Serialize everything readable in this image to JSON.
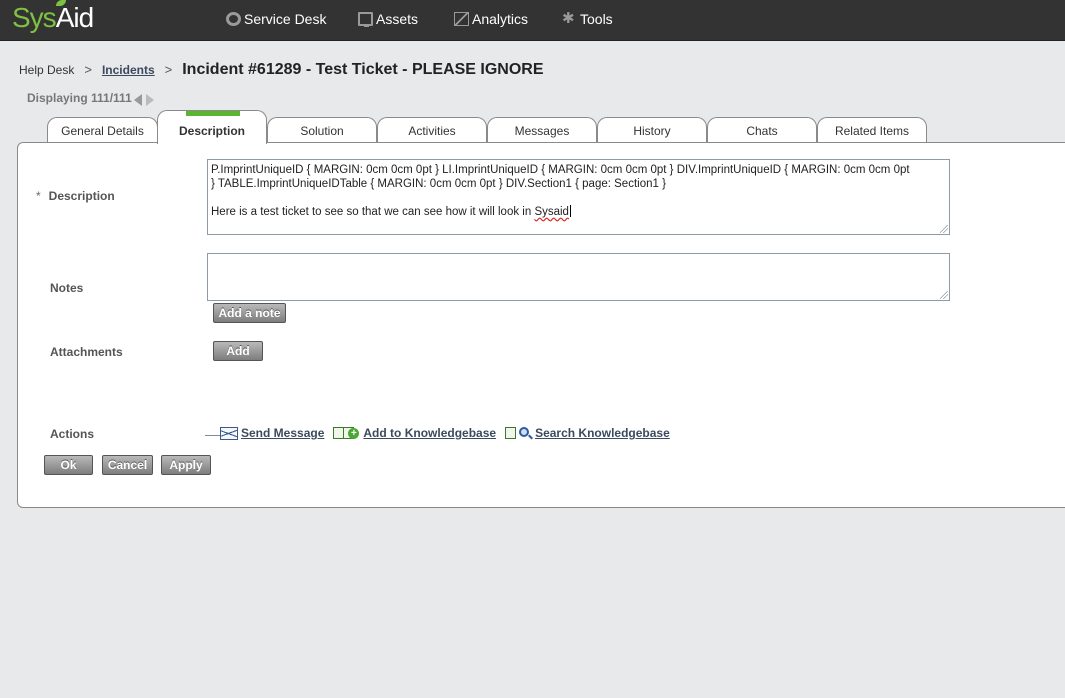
{
  "app": {
    "logo_sys": "Sys",
    "logo_aid": "Aid"
  },
  "nav": [
    {
      "label": "Service Desk",
      "icon": "service-desk-icon"
    },
    {
      "label": "Assets",
      "icon": "monitor-icon"
    },
    {
      "label": "Analytics",
      "icon": "chart-icon"
    },
    {
      "label": "Tools",
      "icon": "puzzle-icon"
    }
  ],
  "breadcrumb": {
    "root": "Help Desk",
    "sep": ">",
    "parent": "Incidents",
    "title": "Incident #61289 -  Test Ticket - PLEASE IGNORE"
  },
  "displaying": "Displaying 111/111",
  "tabs": [
    {
      "label": "General Details"
    },
    {
      "label": "Description"
    },
    {
      "label": "Solution"
    },
    {
      "label": "Activities"
    },
    {
      "label": "Messages"
    },
    {
      "label": "History"
    },
    {
      "label": "Chats"
    },
    {
      "label": "Related Items"
    }
  ],
  "form": {
    "required_mark": "*",
    "description_label": "Description",
    "description_line1": "P.ImprintUniqueID { MARGIN: 0cm 0cm 0pt } LI.ImprintUniqueID { MARGIN: 0cm 0cm 0pt } DIV.ImprintUniqueID { MARGIN: 0cm 0cm 0pt",
    "description_line2": "} TABLE.ImprintUniqueIDTable { MARGIN: 0cm 0cm 0pt } DIV.Section1 { page: Section1 }",
    "description_line3_a": "Here is a test ticket to see so that we can see how it will look in ",
    "description_line3_b": "Sysaid",
    "notes_label": "Notes",
    "notes_value": "",
    "add_note_label": "Add a note",
    "attachments_label": "Attachments",
    "add_label": "Add",
    "actions_label": "Actions",
    "send_message": "Send Message",
    "add_to_kb": "Add to Knowledgebase",
    "search_kb": "Search Knowledgebase",
    "ok": "Ok",
    "cancel": "Cancel",
    "apply": "Apply"
  },
  "colors": {
    "topbar": "#333333",
    "logo_green": "#7ec242",
    "active_tab_marker": "#5cb531",
    "link": "#3b4a5e"
  }
}
